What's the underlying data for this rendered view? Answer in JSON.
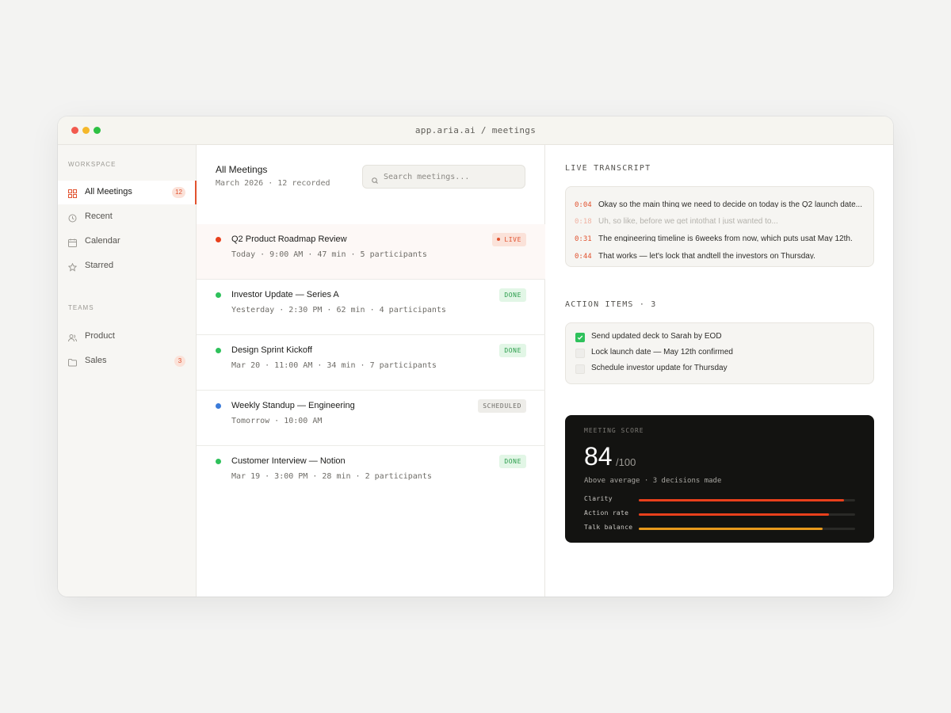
{
  "window": {
    "url": "app.aria.ai / meetings"
  },
  "sidebar": {
    "workspace_label": "WORKSPACE",
    "teams_label": "TEAMS",
    "workspace_items": [
      {
        "label": "All Meetings",
        "badge": "12",
        "icon": "grid-icon",
        "active": true
      },
      {
        "label": "Recent",
        "badge": "",
        "icon": "clock-icon",
        "active": false
      },
      {
        "label": "Calendar",
        "badge": "",
        "icon": "calendar-icon",
        "active": false
      },
      {
        "label": "Starred",
        "badge": "",
        "icon": "star-icon",
        "active": false
      }
    ],
    "team_items": [
      {
        "label": "Product",
        "badge": "",
        "icon": "users-icon"
      },
      {
        "label": "Sales",
        "badge": "3",
        "icon": "folder-icon"
      }
    ]
  },
  "list": {
    "title": "All Meetings",
    "subtitle": "March 2026 · 12 recorded",
    "search_placeholder": "Search meetings...",
    "meetings": [
      {
        "title": "Q2 Product Roadmap Review",
        "meta": "Today · 9:00 AM · 47 min · 5 participants",
        "status": "LIVE",
        "dot_color": "#e8401c"
      },
      {
        "title": "Investor Update — Series A",
        "meta": "Yesterday · 2:30 PM · 62 min · 4 participants",
        "status": "DONE",
        "dot_color": "#2ec15b"
      },
      {
        "title": "Design Sprint Kickoff",
        "meta": "Mar 20 · 11:00 AM · 34 min · 7 participants",
        "status": "DONE",
        "dot_color": "#2ec15b"
      },
      {
        "title": "Weekly Standup — Engineering",
        "meta": "Tomorrow · 10:00 AM",
        "status": "SCHEDULED",
        "dot_color": "#3b7bd9"
      },
      {
        "title": "Customer Interview — Notion",
        "meta": "Mar 19 · 3:00 PM · 28 min · 2 participants",
        "status": "DONE",
        "dot_color": "#2ec15b"
      }
    ]
  },
  "transcript": {
    "label": "LIVE TRANSCRIPT",
    "lines": [
      {
        "time": "0:04",
        "text": "Okay so the main thing we need to decide on today is the Q2 launch date...",
        "faded": false
      },
      {
        "time": "0:18",
        "text": "Uh, so like, before we get intothat I just wanted to...",
        "faded": true
      },
      {
        "time": "0:31",
        "text": "The engineering timeline is 6weeks from now, which puts usat May 12th.",
        "faded": false
      },
      {
        "time": "0:44",
        "text": "That works — let's lock that andtell the investors on Thursday.",
        "faded": false
      }
    ]
  },
  "action_items": {
    "label": "ACTION ITEMS · 3",
    "items": [
      {
        "text": "Send updated deck to Sarah by EOD",
        "done": true
      },
      {
        "text": "Lock launch date — May 12th confirmed",
        "done": false
      },
      {
        "text": "Schedule investor update for Thursday",
        "done": false
      }
    ]
  },
  "score": {
    "label": "MEETING SCORE",
    "value": "84",
    "max": "/100",
    "description": "Above average · 3 decisions made",
    "metrics": [
      {
        "label": "Clarity",
        "fraction": 0.95,
        "color": "#e8401c"
      },
      {
        "label": "Action rate",
        "fraction": 0.88,
        "color": "#e8401c"
      },
      {
        "label": "Talk balance",
        "fraction": 0.85,
        "color": "#e89a1c"
      }
    ]
  }
}
